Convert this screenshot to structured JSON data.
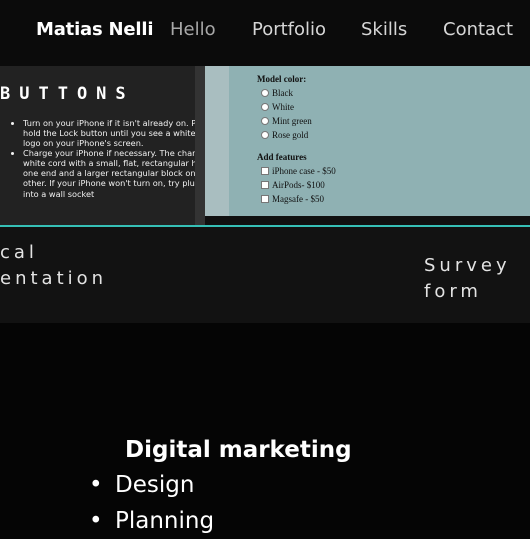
{
  "nav": {
    "brand": "Matias Nelli",
    "links": [
      "Hello",
      "Portfolio",
      "Skills",
      "Contact"
    ]
  },
  "portfolio": {
    "left_card": {
      "heading": "BUTTONS",
      "bullets": [
        "Turn on your iPhone if it isn't already on. Press and hold the Lock button until you see a white Apple logo on your iPhone's screen.",
        "Charge your iPhone if necessary. The charger is a white cord with a small, flat, rectangular head on one end and a larger rectangular block on the other. If your iPhone won't turn on, try plugging it into a wall socket"
      ]
    },
    "left_caption": "cal\nentation",
    "form": {
      "model_label": "Model color:",
      "colors": [
        "Black",
        "White",
        "Mint green",
        "Rose gold"
      ],
      "features_label": "Add features",
      "features": [
        "iPhone case - $50",
        "AirPods- $100",
        "Magsafe - $50"
      ]
    },
    "right_caption": "Survey\nform"
  },
  "skills": {
    "title": "Digital marketing",
    "items": [
      "Design",
      "Planning"
    ]
  },
  "colors": {
    "accent": "#36c0b6",
    "form_background": "#8fb1b3"
  }
}
